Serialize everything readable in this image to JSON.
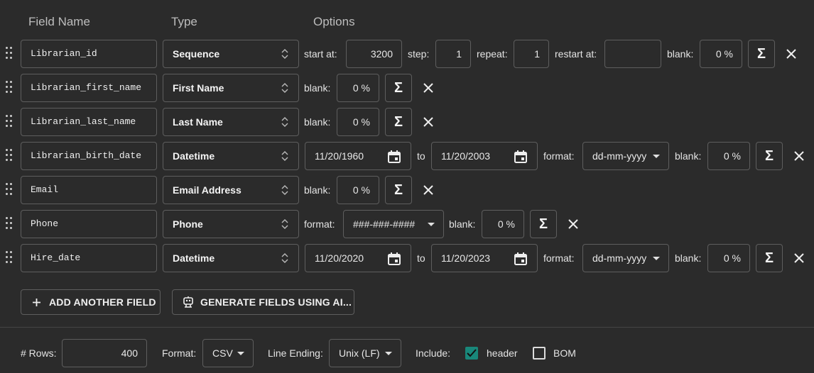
{
  "headers": {
    "field_name": "Field Name",
    "type": "Type",
    "options": "Options"
  },
  "labels": {
    "start_at": "start at:",
    "step": "step:",
    "repeat": "repeat:",
    "restart_at": "restart at:",
    "blank": "blank:",
    "to": "to",
    "format": "format:"
  },
  "rows": [
    {
      "name": "Librarian_id",
      "type": "Sequence",
      "start": "3200",
      "step": "1",
      "repeat": "1",
      "restart": "",
      "blank": "0 %"
    },
    {
      "name": "Librarian_first_name",
      "type": "First Name",
      "blank": "0 %"
    },
    {
      "name": "Librarian_last_name",
      "type": "Last Name",
      "blank": "0 %"
    },
    {
      "name": "Librarian_birth_date",
      "type": "Datetime",
      "from": "11/20/1960",
      "to": "11/20/2003",
      "format": "dd-mm-yyyy",
      "blank": "0 %"
    },
    {
      "name": "Email",
      "type": "Email Address",
      "blank": "0 %"
    },
    {
      "name": "Phone",
      "type": "Phone",
      "format": "###-###-####",
      "blank": "0 %"
    },
    {
      "name": "Hire_date",
      "type": "Datetime",
      "from": "11/20/2020",
      "to": "11/20/2023",
      "format": "dd-mm-yyyy",
      "blank": "0 %"
    }
  ],
  "buttons": {
    "add_field": "ADD ANOTHER FIELD",
    "generate_ai": "GENERATE FIELDS USING AI..."
  },
  "icons": {
    "sigma": "Σ"
  },
  "footer": {
    "rows_label": "# Rows:",
    "rows_value": "400",
    "format_label": "Format:",
    "format_value": "CSV",
    "line_ending_label": "Line Ending:",
    "line_ending_value": "Unix (LF)",
    "include_label": "Include:",
    "header_label": "header",
    "header_checked": true,
    "bom_label": "BOM",
    "bom_checked": false
  },
  "colors": {
    "background": "#2b2b2b",
    "border": "#5e5e5e",
    "checkbox_accent": "#19877a"
  }
}
